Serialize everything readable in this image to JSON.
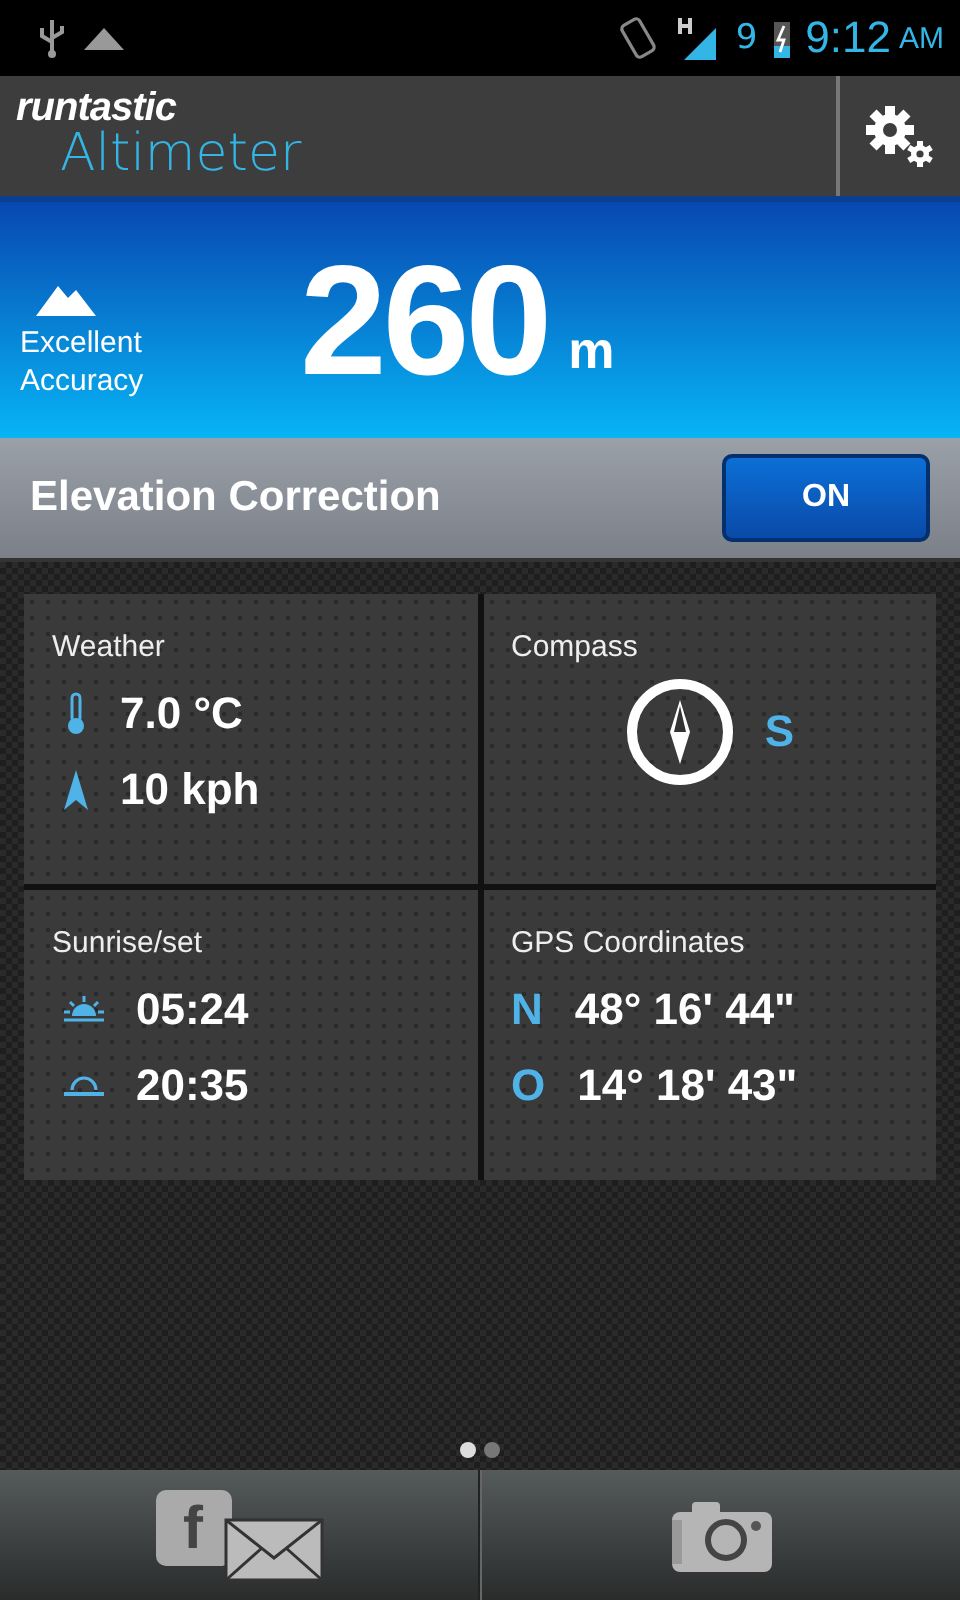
{
  "status_bar": {
    "battery_percent": "9",
    "time": "9:12",
    "meridiem": "AM"
  },
  "header": {
    "brand": "runtastic",
    "app_name": "Altimeter"
  },
  "altitude": {
    "accuracy": "Excellent Accuracy",
    "value": "260",
    "unit": "m"
  },
  "elevation_correction": {
    "label": "Elevation Correction",
    "toggle": {
      "label": "ON",
      "on": true
    }
  },
  "cards": [
    {
      "kind": "weather",
      "title": "Weather",
      "rows": [
        {
          "kind": "temperature",
          "value": "7.0 °C"
        },
        {
          "kind": "wind",
          "value": "10 kph"
        }
      ]
    },
    {
      "kind": "compass",
      "title": "Compass",
      "direction": "S"
    },
    {
      "kind": "sun",
      "title": "Sunrise/set",
      "rows": [
        {
          "kind": "sunrise",
          "value": "05:24"
        },
        {
          "kind": "sunset",
          "value": "20:35"
        }
      ]
    },
    {
      "kind": "gps",
      "title": "GPS Coordinates",
      "rows": [
        {
          "kind": "coordinate",
          "axis": "N",
          "value": "48° 16' 44\""
        },
        {
          "kind": "coordinate",
          "axis": "O",
          "value": "14° 18' 43\""
        }
      ]
    }
  ],
  "page_indicator": [
    {
      "selected": true
    },
    {
      "selected": false
    }
  ],
  "bottom_bar": [
    {
      "kind": "share",
      "icon_letter": "f"
    },
    {
      "kind": "camera"
    }
  ]
}
